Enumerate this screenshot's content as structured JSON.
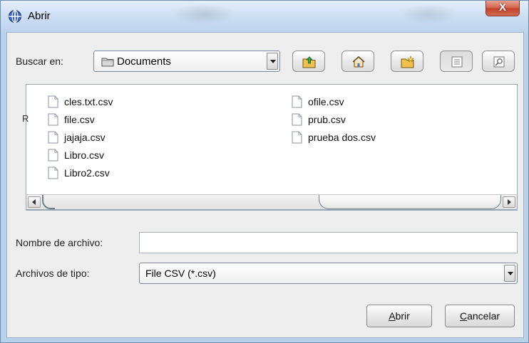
{
  "window": {
    "title": "Abrir",
    "close_label": "X"
  },
  "toolbar": {
    "look_in_label": "Buscar en:",
    "look_in_value": "Documents",
    "buttons": [
      {
        "name": "up-folder-icon"
      },
      {
        "name": "home-icon"
      },
      {
        "name": "new-folder-icon"
      },
      {
        "name": "list-view-icon"
      },
      {
        "name": "details-view-icon"
      }
    ]
  },
  "files": {
    "column1": [
      "cles.txt.csv",
      "file.csv",
      "jajaja.csv",
      "Libro.csv",
      "Libro2.csv"
    ],
    "column2": [
      "ofile.csv",
      "prub.csv",
      "prueba dos.csv"
    ],
    "stray_char": "R"
  },
  "form": {
    "filename_label": "Nombre de archivo:",
    "filename_value": "",
    "filetype_label": "Archivos de tipo:",
    "filetype_value": "File CSV (*.csv)"
  },
  "actions": {
    "open_mnemonic": "A",
    "open_rest": "brir",
    "cancel_mnemonic": "C",
    "cancel_rest": "ancelar"
  }
}
